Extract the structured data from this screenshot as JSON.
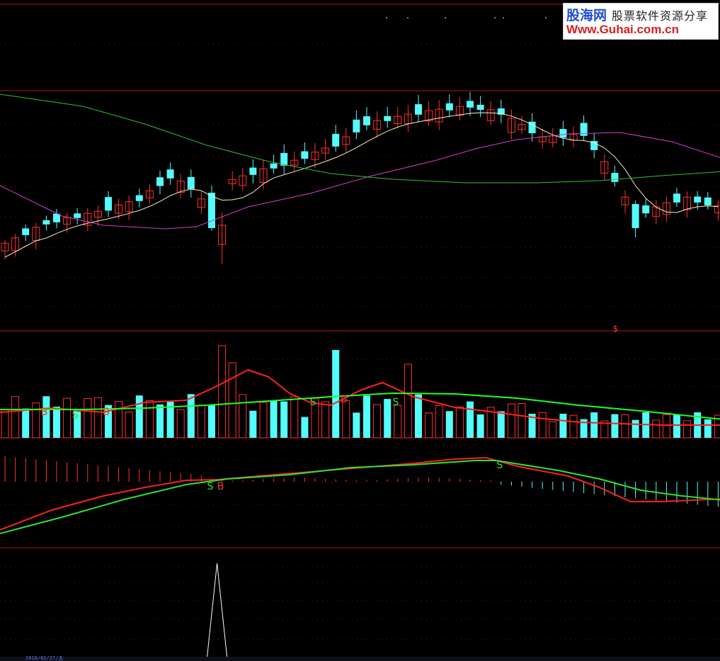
{
  "watermark": {
    "brand": "股海网",
    "tagline": "股票软件资源分享",
    "url": "Www.Guhai.com.cn"
  },
  "date_label": "2016/02/27/五",
  "colors": {
    "background": "#000000",
    "panel_border": "#b01818",
    "grid": "#7a0c0c",
    "up": "#ff3030",
    "down": "#54fcfc",
    "ma_short": "#f0f0c0",
    "ma_mid": "#d040d0",
    "ma_long": "#30c030",
    "vol_ma_fast": "#ff2020",
    "vol_ma_slow": "#20ff20",
    "macd_dif": "#ff2020",
    "macd_dea": "#30e030",
    "spike": "#ffffff"
  },
  "chart_data": [
    {
      "type": "candlestick",
      "panel": "price",
      "series_count": 70,
      "moving_averages": [
        "short",
        "mid",
        "long"
      ],
      "signals": [
        {
          "label": "$",
          "candle": 59
        }
      ]
    },
    {
      "type": "bar",
      "panel": "volume",
      "signals": [
        {
          "label": "B",
          "index": 4,
          "color": "red"
        },
        {
          "label": "S",
          "index": 7,
          "color": "green"
        },
        {
          "label": "B",
          "index": 10,
          "color": "red"
        },
        {
          "label": "S",
          "index": 30,
          "color": "green"
        },
        {
          "label": "B",
          "index": 33,
          "color": "red"
        },
        {
          "label": "S",
          "index": 38,
          "color": "green"
        }
      ]
    },
    {
      "type": "line",
      "panel": "macd",
      "signals": [
        {
          "label": "S",
          "index": 20,
          "color": "green"
        },
        {
          "label": "B",
          "index": 21,
          "color": "red"
        },
        {
          "label": "S",
          "index": 48,
          "color": "green"
        }
      ]
    },
    {
      "type": "line",
      "panel": "spike",
      "spike_index": 21
    }
  ]
}
